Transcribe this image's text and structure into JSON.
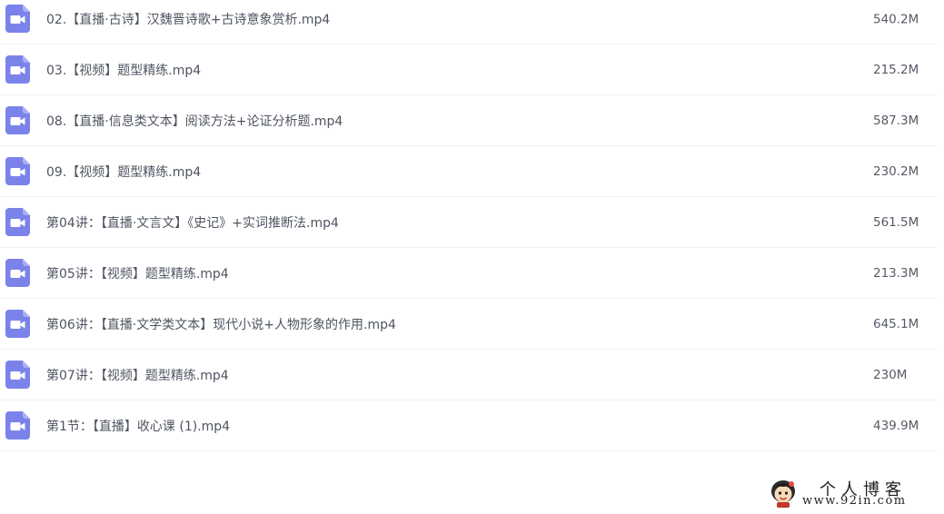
{
  "files": [
    {
      "name": "02.【直播·古诗】汉魏晋诗歌+古诗意象赏析.mp4",
      "size": "540.2M",
      "icon": "video-file-icon"
    },
    {
      "name": "03.【视频】题型精练.mp4",
      "size": "215.2M",
      "icon": "video-file-icon"
    },
    {
      "name": "08.【直播·信息类文本】阅读方法+论证分析题.mp4",
      "size": "587.3M",
      "icon": "video-file-icon"
    },
    {
      "name": "09.【视频】题型精练.mp4",
      "size": "230.2M",
      "icon": "video-file-icon"
    },
    {
      "name": "第04讲：【直播·文言文】《史记》+实词推断法.mp4",
      "size": "561.5M",
      "icon": "video-file-icon"
    },
    {
      "name": "第05讲：【视频】题型精练.mp4",
      "size": "213.3M",
      "icon": "video-file-icon"
    },
    {
      "name": "第06讲：【直播·文学类文本】现代小说+人物形象的作用.mp4",
      "size": "645.1M",
      "icon": "video-file-icon"
    },
    {
      "name": "第07讲：【视频】题型精练.mp4",
      "size": "230M",
      "icon": "video-file-icon"
    },
    {
      "name": "第1节：【直播】收心课 (1).mp4",
      "size": "439.9M",
      "icon": "video-file-icon"
    }
  ],
  "watermark": {
    "title": "个人博客",
    "url": "www.92in.com",
    "icon": "mascot-logo"
  },
  "colors": {
    "icon_purple": "#7b83eb",
    "text": "#4e5461",
    "divider": "#eef0f3"
  }
}
